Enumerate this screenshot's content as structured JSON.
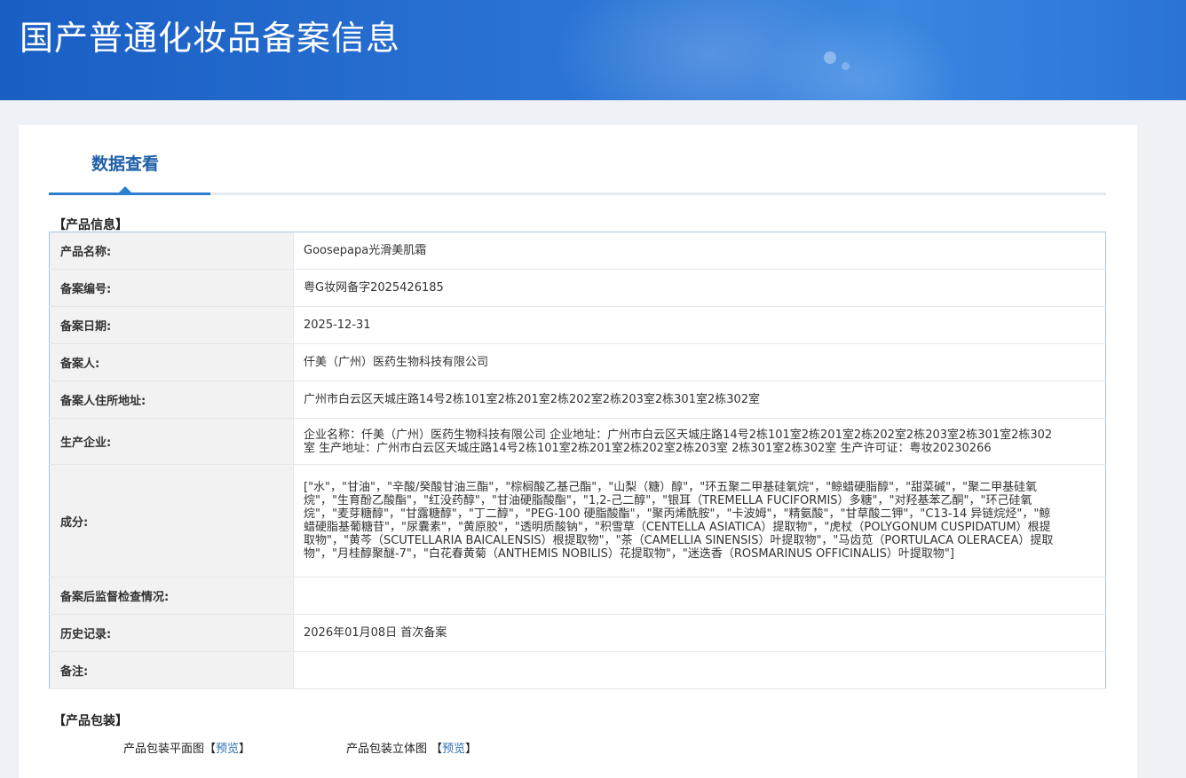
{
  "banner": {
    "title": "国产普通化妆品备案信息"
  },
  "tabs": [
    {
      "label": "数据查看",
      "active": true
    }
  ],
  "product_info": {
    "section_title": "【产品信息】",
    "rows": [
      {
        "label": "产品名称:",
        "value": "Goosepapa光滑美肌霜"
      },
      {
        "label": "备案编号:",
        "value": "粤G妆网备字2025426185"
      },
      {
        "label": "备案日期:",
        "value": "2025-12-31"
      },
      {
        "label": "备案人:",
        "value": "仟美（广州）医药生物科技有限公司"
      },
      {
        "label": "备案人住所地址:",
        "value": "广州市白云区天城庄路14号2栋101室2栋201室2栋202室2栋203室2栋301室2栋302室"
      },
      {
        "label": "生产企业:",
        "value": "企业名称：仟美（广州）医药生物科技有限公司 企业地址：广州市白云区天城庄路14号2栋101室2栋201室2栋202室2栋203室2栋301室2栋302室 生产地址：广州市白云区天城庄路14号2栋101室2栋201室2栋202室2栋203室 2栋301室2栋302室 生产许可证：粤妆20230266"
      },
      {
        "label": "成分:",
        "value": "[\"水\"，\"甘油\"，\"辛酸/癸酸甘油三酯\"，\"棕榈酸乙基己酯\"，\"山梨（糖）醇\"，\"环五聚二甲基硅氧烷\"，\"鲸蜡硬脂醇\"，\"甜菜碱\"，\"聚二甲基硅氧烷\"，\"生育酚乙酸酯\"，\"红没药醇\"，\"甘油硬脂酸酯\"，\"1,2-己二醇\"，\"银耳（TREMELLA FUCIFORMIS）多糖\"，\"对羟基苯乙酮\"，\"环己硅氧烷\"，\"麦芽糖醇\"，\"甘露糖醇\"，\"丁二醇\"，\"PEG-100 硬脂酸酯\"，\"聚丙烯酰胺\"，\"卡波姆\"，\"精氨酸\"，\"甘草酸二钾\"，\"C13-14 异链烷烃\"，\"鲸蜡硬脂基葡糖苷\"，\"尿囊素\"，\"黄原胶\"，\"透明质酸钠\"，\"积雪草（CENTELLA ASIATICA）提取物\"，\"虎杖（POLYGONUM CUSPIDATUM）根提取物\"，\"黄芩（SCUTELLARIA BAICALENSIS）根提取物\"，\"茶（CAMELLIA SINENSIS）叶提取物\"，\"马齿苋（PORTULACA OLERACEA）提取物\"，\"月桂醇聚醚-7\"，\"白花春黄菊（ANTHEMIS NOBILIS）花提取物\"，\"迷迭香（ROSMARINUS OFFICINALIS）叶提取物\"]"
      },
      {
        "label": "备案后监督检查情况:",
        "value": ""
      },
      {
        "label": "历史记录:",
        "value": "2026年01月08日 首次备案"
      },
      {
        "label": "备注:",
        "value": ""
      }
    ]
  },
  "packaging": {
    "section_title": "【产品包装】",
    "items": [
      {
        "label": "产品包装平面图",
        "link_label": "预览"
      },
      {
        "label": "产品包装立体图",
        "link_label": "预览"
      }
    ]
  },
  "colors": {
    "banner_blue": "#2a72d3",
    "accent_blue": "#1f5fa8",
    "link_blue": "#2a6fb6",
    "table_border": "#a9c4df",
    "label_bg": "#f2f2f2"
  }
}
